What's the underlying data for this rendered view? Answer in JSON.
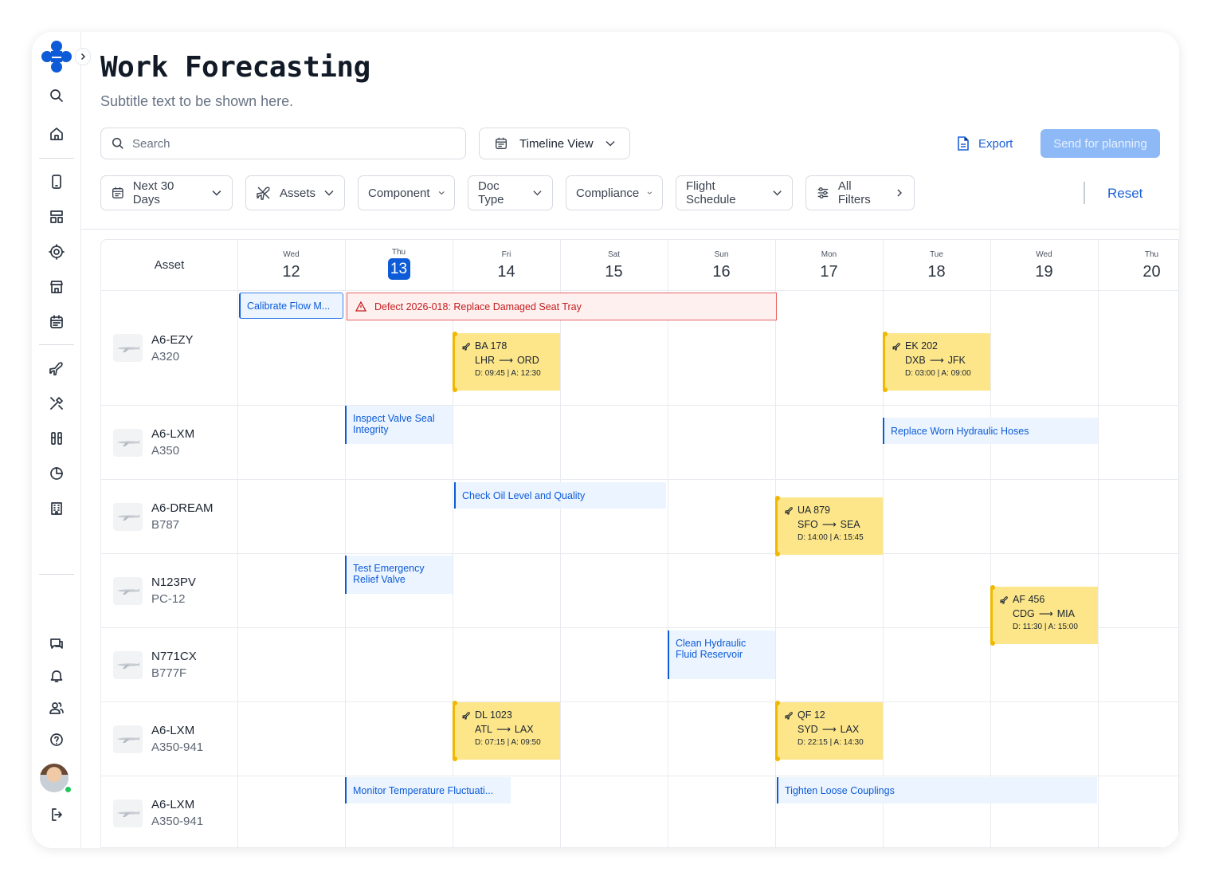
{
  "header": {
    "title": "Work Forecasting",
    "subtitle": "Subtitle text to be shown here."
  },
  "search": {
    "placeholder": "Search"
  },
  "view_select": {
    "value": "Timeline View"
  },
  "actions": {
    "export_label": "Export",
    "send_label": "Send for planning"
  },
  "filters": {
    "date_range": "Next 30 Days",
    "assets": "Assets",
    "component": "Component",
    "doc_type": "Doc Type",
    "compliance": "Compliance",
    "flight_schedule": "Flight Schedule",
    "all_filters": "All Filters",
    "reset": "Reset"
  },
  "calendar": {
    "asset_header": "Asset",
    "days": [
      {
        "dow": "Wed",
        "num": "12"
      },
      {
        "dow": "Thu",
        "num": "13",
        "today": true
      },
      {
        "dow": "Fri",
        "num": "14"
      },
      {
        "dow": "Sat",
        "num": "15"
      },
      {
        "dow": "Sun",
        "num": "16"
      },
      {
        "dow": "Mon",
        "num": "17"
      },
      {
        "dow": "Tue",
        "num": "18"
      },
      {
        "dow": "Wed",
        "num": "19"
      },
      {
        "dow": "Thu",
        "num": "20"
      }
    ],
    "assets": [
      {
        "reg": "A6-EZY",
        "type": "A320"
      },
      {
        "reg": "A6-LXM",
        "type": "A350"
      },
      {
        "reg": "A6-DREAM",
        "type": "B787"
      },
      {
        "reg": "N123PV",
        "type": "PC-12"
      },
      {
        "reg": "N771CX",
        "type": "B777F"
      },
      {
        "reg": "A6-LXM",
        "type": "A350-941"
      },
      {
        "reg": "A6-LXM",
        "type": "A350-941"
      }
    ],
    "tasks": {
      "calibrate": "Calibrate Flow M...",
      "defect": "Defect 2026-018: Replace Damaged Seat Tray",
      "inspect_valve": "Inspect Valve Seal Integrity",
      "replace_hoses": "Replace Worn Hydraulic Hoses",
      "check_oil": "Check Oil Level and Quality",
      "test_relief": "Test Emergency Relief Valve",
      "clean_reservoir": "Clean Hydraulic Fluid Reservoir",
      "monitor_temp": "Monitor Temperature Fluctuati...",
      "tighten": "Tighten Loose Couplings"
    },
    "flights": {
      "ba178": {
        "code": "BA 178",
        "from": "LHR",
        "to": "ORD",
        "times": "D: 09:45 | A: 12:30"
      },
      "ek202": {
        "code": "EK 202",
        "from": "DXB",
        "to": "JFK",
        "times": "D: 03:00 | A: 09:00"
      },
      "ua879": {
        "code": "UA 879",
        "from": "SFO",
        "to": "SEA",
        "times": "D: 14:00 | A: 15:45"
      },
      "af456": {
        "code": "AF 456",
        "from": "CDG",
        "to": "MIA",
        "times": "D: 11:30 | A: 15:00"
      },
      "dl1023": {
        "code": "DL 1023",
        "from": "ATL",
        "to": "LAX",
        "times": "D: 07:15 | A: 09:50"
      },
      "qf12": {
        "code": "QF 12",
        "from": "SYD",
        "to": "LAX",
        "times": "D: 22:15 | A: 14:30"
      }
    }
  },
  "colors": {
    "accent": "#0d5bd7",
    "task_bg": "#ebf4ff",
    "flight_bg": "#fde68a",
    "flight_border": "#f0b800",
    "defect_bg": "#fff0f0",
    "defect_text": "#c41c1c",
    "send_disabled": "#8db9f7",
    "online": "#22c55e"
  },
  "icons": {
    "sidebar": [
      "search-icon",
      "home-icon",
      "tablet-icon",
      "layout-icon",
      "gear-icon",
      "store-icon",
      "calendar-icon",
      "plane-icon",
      "tools-icon",
      "toolkit-icon",
      "pie-chart-icon",
      "building-icon",
      "chat-icon",
      "bell-icon",
      "users-icon",
      "help-icon",
      "logout-icon"
    ]
  }
}
